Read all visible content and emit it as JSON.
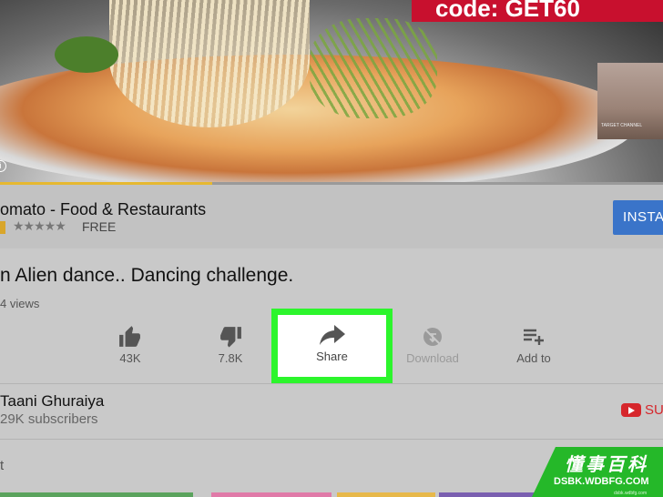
{
  "video": {
    "promo_text": "code: GET60",
    "thumbnail_caption": "TARGET CHANNEL",
    "info_icon": "i",
    "progress_fraction": 0.32
  },
  "ad": {
    "title": "omato - Food & Restaurants",
    "stars": "★★★★★",
    "rating_stars": 4.5,
    "price": "FREE",
    "install_label": "INSTA"
  },
  "video_title": "n Alien dance.. Dancing challenge.",
  "views": "4 views",
  "actions": {
    "like": {
      "icon": "thumb-up-icon",
      "label": "43K"
    },
    "dislike": {
      "icon": "thumb-down-icon",
      "label": "7.8K"
    },
    "share": {
      "icon": "share-arrow-icon",
      "label": "Share"
    },
    "download": {
      "icon": "download-disabled-icon",
      "label": "Download"
    },
    "add_to": {
      "icon": "playlist-add-icon",
      "label": "Add to"
    }
  },
  "channel": {
    "name": "Taani Ghuraiya",
    "subscribers": "29K subscribers",
    "subscribe_label": "SU"
  },
  "section_label": "t",
  "watermark": {
    "chinese": "懂事百科",
    "url": "DSBK.WDBFG.COM",
    "small": "dsbk.wdbfg.com"
  },
  "colors": {
    "highlight": "#2cf52c",
    "install_blue": "#3a74c9",
    "progress_yellow": "#e6b830",
    "youtube_red": "#d6262b",
    "watermark_green": "#25b829"
  }
}
